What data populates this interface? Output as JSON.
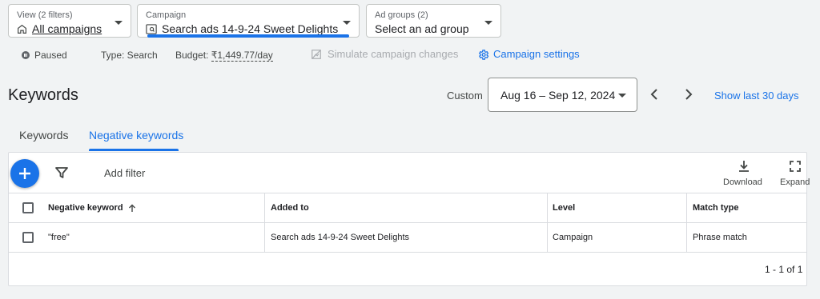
{
  "view_selector": {
    "label": "View (2 filters)",
    "value": "All campaigns"
  },
  "campaign_selector": {
    "label": "Campaign",
    "value": "Search ads 14-9-24 Sweet Delights"
  },
  "adgroup_selector": {
    "label": "Ad groups (2)",
    "value": "Select an ad group"
  },
  "info": {
    "status": "Paused",
    "type": "Type: Search",
    "budget_label": "Budget:",
    "budget_value": "₹1,449.77/day",
    "simulate": "Simulate campaign changes",
    "settings": "Campaign settings"
  },
  "page_title": "Keywords",
  "date": {
    "preset": "Custom",
    "range": "Aug 16 – Sep 12, 2024",
    "show_last": "Show last 30 days"
  },
  "tabs": [
    {
      "label": "Keywords",
      "active": false
    },
    {
      "label": "Negative keywords",
      "active": true
    }
  ],
  "toolbar": {
    "add_filter": "Add filter",
    "download": "Download",
    "expand": "Expand"
  },
  "table": {
    "columns": [
      "Negative keyword",
      "Added to",
      "Level",
      "Match type"
    ],
    "rows": [
      {
        "keyword": "\"free\"",
        "added_to": "Search ads 14-9-24 Sweet Delights",
        "level": "Campaign",
        "match_type": "Phrase match"
      }
    ],
    "pagination": "1 - 1 of 1"
  },
  "colors": {
    "accent": "#1a73e8",
    "background": "#f1f3f4"
  }
}
